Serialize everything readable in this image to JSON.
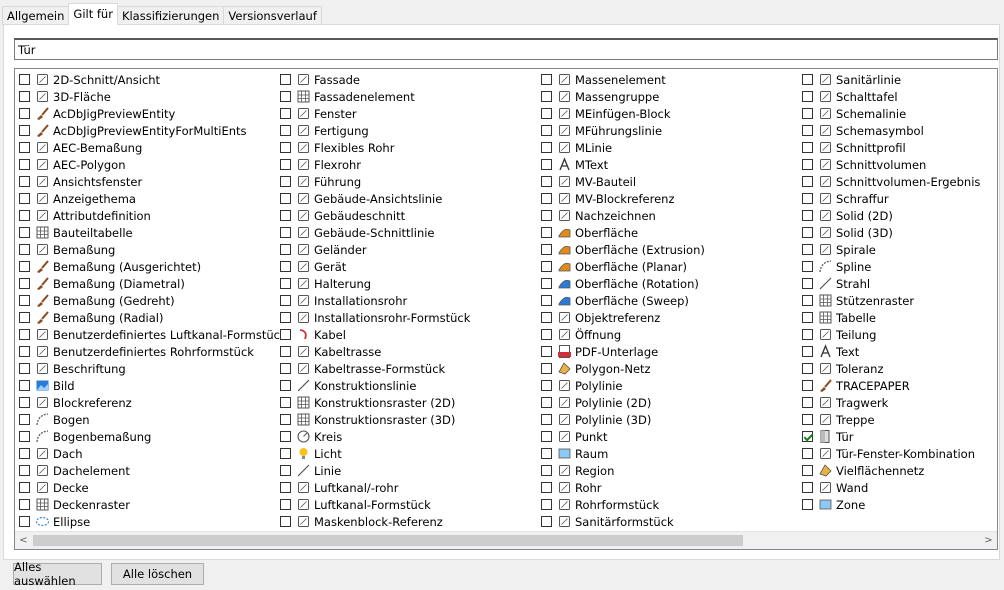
{
  "tabs": [
    {
      "label": "Allgemein",
      "active": false
    },
    {
      "label": "Gilt für",
      "active": true
    },
    {
      "label": "Klassifizierungen",
      "active": false
    },
    {
      "label": "Versionsverlauf",
      "active": false
    }
  ],
  "filter": {
    "value": "Tür"
  },
  "columns": [
    [
      {
        "label": "2D-Schnitt/Ansicht",
        "icon": "section-elevation-icon",
        "checked": false
      },
      {
        "label": "3D-Fläche",
        "icon": "3d-face-icon",
        "checked": false
      },
      {
        "label": "AcDbJigPreviewEntity",
        "icon": "brush-icon",
        "checked": false
      },
      {
        "label": "AcDbJigPreviewEntityForMultiEnts",
        "icon": "brush-icon",
        "checked": false
      },
      {
        "label": "AEC-Bemaßung",
        "icon": "aec-dimension-icon",
        "checked": false
      },
      {
        "label": "AEC-Polygon",
        "icon": "polygon-icon",
        "checked": false
      },
      {
        "label": "Ansichtsfenster",
        "icon": "viewport-icon",
        "checked": false
      },
      {
        "label": "Anzeigethema",
        "icon": "display-theme-icon",
        "checked": false
      },
      {
        "label": "Attributdefinition",
        "icon": "attribute-icon",
        "checked": false
      },
      {
        "label": "Bauteiltabelle",
        "icon": "table-icon",
        "checked": false
      },
      {
        "label": "Bemaßung",
        "icon": "dimension-icon",
        "checked": false
      },
      {
        "label": "Bemaßung (Ausgerichtet)",
        "icon": "brush-icon",
        "checked": false
      },
      {
        "label": "Bemaßung (Diametral)",
        "icon": "brush-icon",
        "checked": false
      },
      {
        "label": "Bemaßung (Gedreht)",
        "icon": "brush-icon",
        "checked": false
      },
      {
        "label": "Bemaßung (Radial)",
        "icon": "brush-icon",
        "checked": false
      },
      {
        "label": "Benutzerdefiniertes Luftkanal-Formstück",
        "icon": "duct-fitting-icon",
        "checked": false
      },
      {
        "label": "Benutzerdefiniertes Rohrformstück",
        "icon": "pipe-fitting-icon",
        "checked": false
      },
      {
        "label": "Beschriftung",
        "icon": "label-icon",
        "checked": false
      },
      {
        "label": "Bild",
        "icon": "image-icon",
        "checked": false
      },
      {
        "label": "Blockreferenz",
        "icon": "block-reference-icon",
        "checked": false
      },
      {
        "label": "Bogen",
        "icon": "arc-icon",
        "checked": false
      },
      {
        "label": "Bogenbemaßung",
        "icon": "arc-dimension-icon",
        "checked": false
      },
      {
        "label": "Dach",
        "icon": "roof-icon",
        "checked": false
      },
      {
        "label": "Dachelement",
        "icon": "roof-slab-icon",
        "checked": false
      },
      {
        "label": "Decke",
        "icon": "slab-icon",
        "checked": false
      },
      {
        "label": "Deckenraster",
        "icon": "ceiling-grid-icon",
        "checked": false
      },
      {
        "label": "Ellipse",
        "icon": "ellipse-icon",
        "checked": false
      }
    ],
    [
      {
        "label": "Fassade",
        "icon": "curtain-wall-icon",
        "checked": false
      },
      {
        "label": "Fassadenelement",
        "icon": "curtain-wall-unit-icon",
        "checked": false
      },
      {
        "label": "Fenster",
        "icon": "window-icon",
        "checked": false
      },
      {
        "label": "Fertigung",
        "icon": "fabrication-icon",
        "checked": false
      },
      {
        "label": "Flexibles Rohr",
        "icon": "flex-pipe-icon",
        "checked": false
      },
      {
        "label": "Flexrohr",
        "icon": "flex-duct-icon",
        "checked": false
      },
      {
        "label": "Führung",
        "icon": "leader-icon",
        "checked": false
      },
      {
        "label": "Gebäude-Ansichtslinie",
        "icon": "building-elevation-line-icon",
        "checked": false
      },
      {
        "label": "Gebäudeschnitt",
        "icon": "building-section-icon",
        "checked": false
      },
      {
        "label": "Gebäude-Schnittlinie",
        "icon": "building-section-line-icon",
        "checked": false
      },
      {
        "label": "Geländer",
        "icon": "railing-icon",
        "checked": false
      },
      {
        "label": "Gerät",
        "icon": "device-icon",
        "checked": false
      },
      {
        "label": "Halterung",
        "icon": "hanger-icon",
        "checked": false
      },
      {
        "label": "Installationsrohr",
        "icon": "conduit-icon",
        "checked": false
      },
      {
        "label": "Installationsrohr-Formstück",
        "icon": "conduit-fitting-icon",
        "checked": false
      },
      {
        "label": "Kabel",
        "icon": "wire-icon",
        "checked": false
      },
      {
        "label": "Kabeltrasse",
        "icon": "cable-tray-icon",
        "checked": false
      },
      {
        "label": "Kabeltrasse-Formstück",
        "icon": "cable-tray-fitting-icon",
        "checked": false
      },
      {
        "label": "Konstruktionslinie",
        "icon": "construction-line-icon",
        "checked": false
      },
      {
        "label": "Konstruktionsraster (2D)",
        "icon": "grid-2d-icon",
        "checked": false
      },
      {
        "label": "Konstruktionsraster (3D)",
        "icon": "grid-3d-icon",
        "checked": false
      },
      {
        "label": "Kreis",
        "icon": "circle-icon",
        "checked": false
      },
      {
        "label": "Licht",
        "icon": "light-icon",
        "checked": false
      },
      {
        "label": "Linie",
        "icon": "line-icon",
        "checked": false
      },
      {
        "label": "Luftkanal/-rohr",
        "icon": "duct-icon",
        "checked": false
      },
      {
        "label": "Luftkanal-Formstück",
        "icon": "duct-fitting-icon",
        "checked": false
      },
      {
        "label": "Maskenblock-Referenz",
        "icon": "mask-block-icon",
        "checked": false
      }
    ],
    [
      {
        "label": "Massenelement",
        "icon": "mass-element-icon",
        "checked": false
      },
      {
        "label": "Massengruppe",
        "icon": "mass-group-icon",
        "checked": false
      },
      {
        "label": "MEinfügen-Block",
        "icon": "minsert-icon",
        "checked": false
      },
      {
        "label": "MFührungslinie",
        "icon": "mleader-icon",
        "checked": false
      },
      {
        "label": "MLinie",
        "icon": "mline-icon",
        "checked": false
      },
      {
        "label": "MText",
        "icon": "mtext-icon",
        "checked": false
      },
      {
        "label": "MV-Bauteil",
        "icon": "mv-part-icon",
        "checked": false
      },
      {
        "label": "MV-Blockreferenz",
        "icon": "mv-block-icon",
        "checked": false
      },
      {
        "label": "Nachzeichnen",
        "icon": "trace-icon",
        "checked": false
      },
      {
        "label": "Oberfläche",
        "icon": "surface-icon",
        "checked": false
      },
      {
        "label": "Oberfläche (Extrusion)",
        "icon": "surface-extrusion-icon",
        "checked": false
      },
      {
        "label": "Oberfläche (Planar)",
        "icon": "surface-planar-icon",
        "checked": false
      },
      {
        "label": "Oberfläche (Rotation)",
        "icon": "surface-revolve-icon",
        "checked": false
      },
      {
        "label": "Oberfläche (Sweep)",
        "icon": "surface-sweep-icon",
        "checked": false
      },
      {
        "label": "Objektreferenz",
        "icon": "object-reference-icon",
        "checked": false
      },
      {
        "label": "Öffnung",
        "icon": "opening-icon",
        "checked": false
      },
      {
        "label": "PDF-Unterlage",
        "icon": "pdf-icon",
        "checked": false
      },
      {
        "label": "Polygon-Netz",
        "icon": "polygon-mesh-icon",
        "checked": false
      },
      {
        "label": "Polylinie",
        "icon": "polyline-icon",
        "checked": false
      },
      {
        "label": "Polylinie (2D)",
        "icon": "polyline-2d-icon",
        "checked": false
      },
      {
        "label": "Polylinie (3D)",
        "icon": "polyline-3d-icon",
        "checked": false
      },
      {
        "label": "Punkt",
        "icon": "point-icon",
        "checked": false
      },
      {
        "label": "Raum",
        "icon": "space-icon",
        "checked": false
      },
      {
        "label": "Region",
        "icon": "region-icon",
        "checked": false
      },
      {
        "label": "Rohr",
        "icon": "pipe-icon",
        "checked": false
      },
      {
        "label": "Rohrformstück",
        "icon": "pipe-fitting-icon",
        "checked": false
      },
      {
        "label": "Sanitärformstück",
        "icon": "plumbing-fitting-icon",
        "checked": false
      }
    ],
    [
      {
        "label": "Sanitärlinie",
        "icon": "plumbing-line-icon",
        "checked": false
      },
      {
        "label": "Schalttafel",
        "icon": "panel-icon",
        "checked": false
      },
      {
        "label": "Schemalinie",
        "icon": "schematic-line-icon",
        "checked": false
      },
      {
        "label": "Schemasymbol",
        "icon": "schematic-symbol-icon",
        "checked": false
      },
      {
        "label": "Schnittprofil",
        "icon": "section-profile-icon",
        "checked": false
      },
      {
        "label": "Schnittvolumen",
        "icon": "section-volume-icon",
        "checked": false
      },
      {
        "label": "Schnittvolumen-Ergebnis",
        "icon": "section-result-icon",
        "checked": false
      },
      {
        "label": "Schraffur",
        "icon": "hatch-icon",
        "checked": false
      },
      {
        "label": "Solid (2D)",
        "icon": "solid-2d-icon",
        "checked": false
      },
      {
        "label": "Solid (3D)",
        "icon": "solid-3d-icon",
        "checked": false
      },
      {
        "label": "Spirale",
        "icon": "helix-icon",
        "checked": false
      },
      {
        "label": "Spline",
        "icon": "spline-icon",
        "checked": false
      },
      {
        "label": "Strahl",
        "icon": "ray-icon",
        "checked": false
      },
      {
        "label": "Stützenraster",
        "icon": "column-grid-icon",
        "checked": false
      },
      {
        "label": "Tabelle",
        "icon": "table-icon",
        "checked": false
      },
      {
        "label": "Teilung",
        "icon": "division-icon",
        "checked": false
      },
      {
        "label": "Text",
        "icon": "text-icon",
        "checked": false
      },
      {
        "label": "Toleranz",
        "icon": "tolerance-icon",
        "checked": false
      },
      {
        "label": "TRACEPAPER",
        "icon": "brush-icon",
        "checked": false
      },
      {
        "label": "Tragwerk",
        "icon": "structural-member-icon",
        "checked": false
      },
      {
        "label": "Treppe",
        "icon": "stair-icon",
        "checked": false
      },
      {
        "label": "Tür",
        "icon": "door-icon",
        "checked": true
      },
      {
        "label": "Tür-Fenster-Kombination",
        "icon": "door-window-assembly-icon",
        "checked": false
      },
      {
        "label": "Vielflächennetz",
        "icon": "polyface-mesh-icon",
        "checked": false
      },
      {
        "label": "Wand",
        "icon": "wall-icon",
        "checked": false
      },
      {
        "label": "Zone",
        "icon": "zone-icon",
        "checked": false
      }
    ]
  ],
  "scrollbar": {
    "left_arrow": "<",
    "right_arrow": ">"
  },
  "buttons": {
    "select_all": "Alles auswählen",
    "clear_all": "Alle löschen"
  },
  "colors": {
    "accent_brush": "#8a4a1e",
    "check": "#1a7f1a",
    "blue_icon": "#2b7bd6",
    "orange_icon": "#e08a1e"
  }
}
